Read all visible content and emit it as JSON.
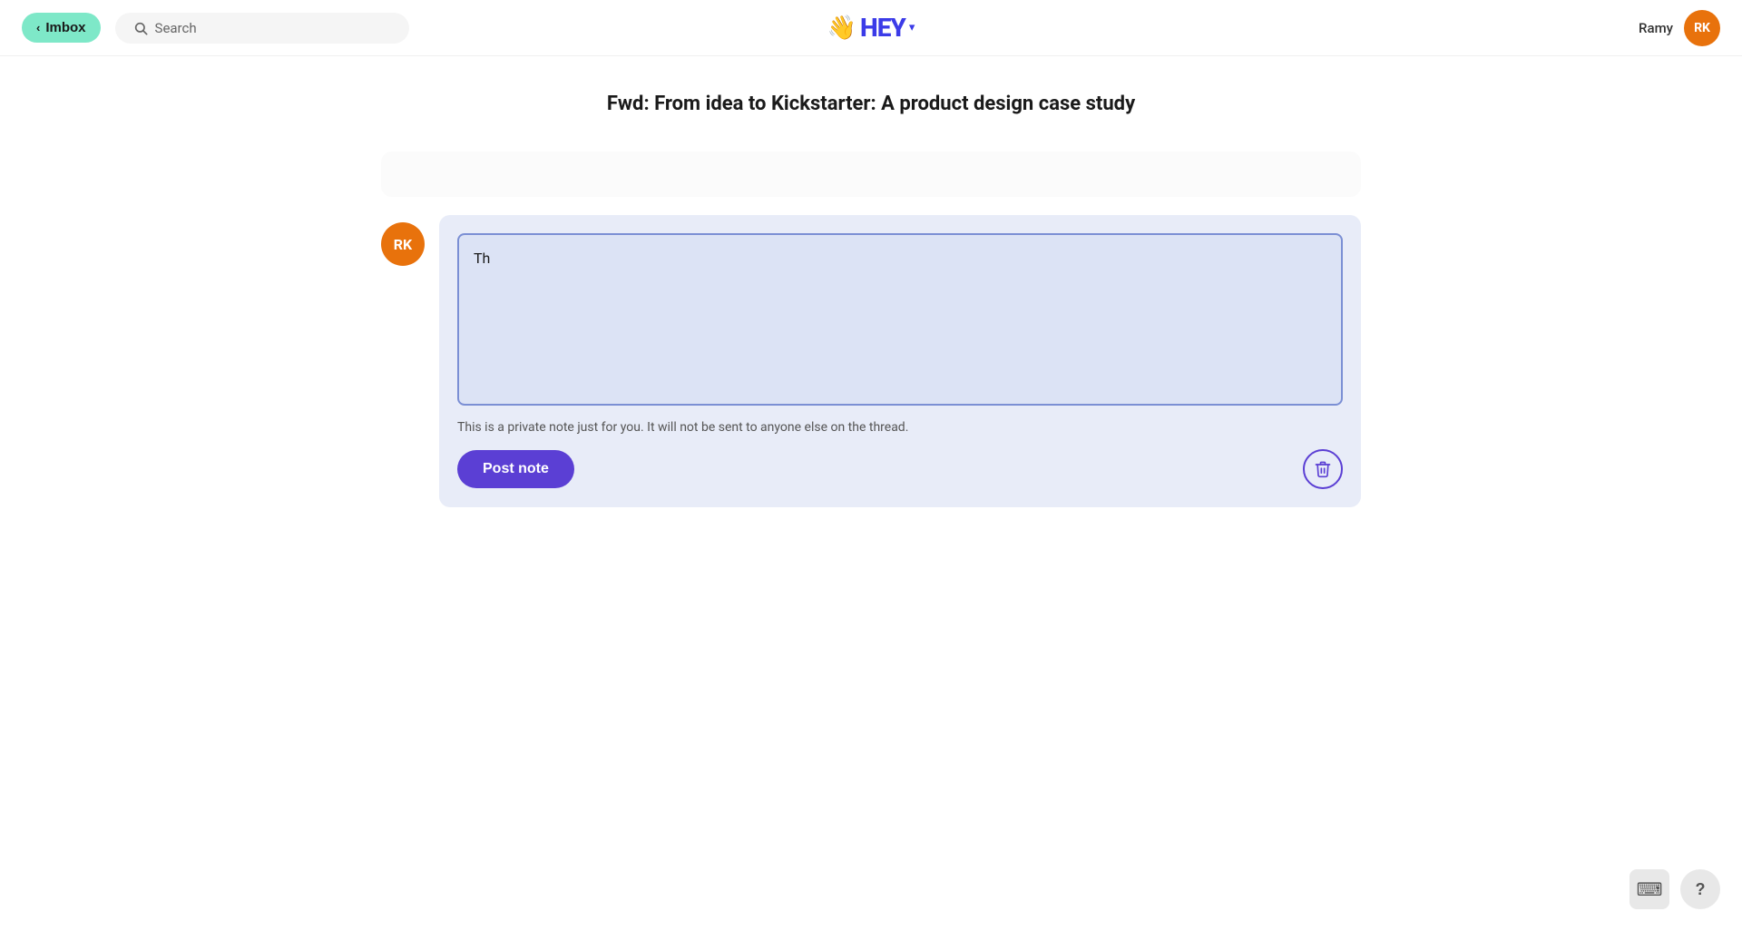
{
  "header": {
    "imbox_label": "Imbox",
    "search_placeholder": "Search",
    "logo_hand": "👋",
    "logo_text": "HEY",
    "dropdown_arrow": "▾",
    "user_name": "Ramy",
    "user_initials": "RK",
    "user_avatar_color": "#e8720c"
  },
  "email": {
    "title": "Fwd: From idea to Kickstarter: A product design case study"
  },
  "note_composer": {
    "avatar_initials": "RK",
    "avatar_color": "#e8720c",
    "textarea_content": "Th",
    "private_note_text": "This is a private note just for you. It will not be sent to anyone else on the thread.",
    "post_button_label": "Post note"
  },
  "bottom_buttons": {
    "keyboard_icon": "⌨",
    "help_icon": "?"
  },
  "colors": {
    "imbox_bg": "#7ee8c8",
    "post_note_bg": "#5b3fd4",
    "note_box_bg": "#e8ecf8",
    "textarea_bg": "#dce3f5",
    "textarea_border": "#7b8fd4",
    "trash_border": "#5b3fd4",
    "hey_logo": "#3b3be8"
  }
}
